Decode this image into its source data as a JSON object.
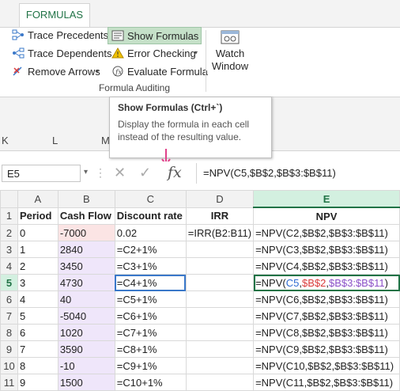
{
  "ribbon": {
    "tab_label": "FORMULAS",
    "items_left": [
      {
        "label": "Trace Precedents",
        "icon": "trace-precedents-icon"
      },
      {
        "label": "Trace Dependents",
        "icon": "trace-dependents-icon"
      },
      {
        "label": "Remove Arrows",
        "icon": "remove-arrows-icon"
      }
    ],
    "items_right": [
      {
        "label": "Show Formulas",
        "icon": "show-formulas-icon",
        "active": true
      },
      {
        "label": "Error Checking",
        "icon": "error-checking-icon"
      },
      {
        "label": "Evaluate Formula",
        "icon": "evaluate-formula-icon"
      }
    ],
    "group_label": "Formula Auditing",
    "watch_window_line1": "Watch",
    "watch_window_line2": "Window"
  },
  "tooltip": {
    "title": "Show Formulas (Ctrl+`)",
    "line1": "Display the formula in each cell",
    "line2": "instead of the resulting value."
  },
  "old_columns": [
    "K",
    "L",
    "M"
  ],
  "formula_bar": {
    "name_box": "E5",
    "fx_label": "fx",
    "formula": "=NPV(C5,$B$2,$B$3:$B$11)"
  },
  "sheet": {
    "columns": [
      "A",
      "B",
      "C",
      "D",
      "E"
    ],
    "rows": [
      {
        "n": "1",
        "cells": [
          "Period",
          "Cash Flow",
          "Discount rate",
          "IRR",
          "NPV"
        ]
      },
      {
        "n": "2",
        "cells": [
          "0",
          "-7000",
          "0.02",
          "=IRR(B2:B11)",
          "=NPV(C2,$B$2,$B$3:$B$11)"
        ]
      },
      {
        "n": "3",
        "cells": [
          "1",
          "2840",
          "=C2+1%",
          "",
          "=NPV(C3,$B$2,$B$3:$B$11)"
        ]
      },
      {
        "n": "4",
        "cells": [
          "2",
          "3450",
          "=C3+1%",
          "",
          "=NPV(C4,$B$2,$B$3:$B$11)"
        ]
      },
      {
        "n": "5",
        "cells": [
          "3",
          "4730",
          "=C4+1%",
          "",
          "=NPV(C5,$B$2,$B$3:$B$11)"
        ]
      },
      {
        "n": "6",
        "cells": [
          "4",
          "40",
          "=C5+1%",
          "",
          "=NPV(C6,$B$2,$B$3:$B$11)"
        ]
      },
      {
        "n": "7",
        "cells": [
          "5",
          "-5040",
          "=C6+1%",
          "",
          "=NPV(C7,$B$2,$B$3:$B$11)"
        ]
      },
      {
        "n": "8",
        "cells": [
          "6",
          "1020",
          "=C7+1%",
          "",
          "=NPV(C8,$B$2,$B$3:$B$11)"
        ]
      },
      {
        "n": "9",
        "cells": [
          "7",
          "3590",
          "=C8+1%",
          "",
          "=NPV(C9,$B$2,$B$3:$B$11)"
        ]
      },
      {
        "n": "10",
        "cells": [
          "8",
          "-10",
          "=C9+1%",
          "",
          "=NPV(C10,$B$2,$B$3:$B$11)"
        ]
      },
      {
        "n": "11",
        "cells": [
          "9",
          "1500",
          "=C10+1%",
          "",
          "=NPV(C11,$B$2,$B$3:$B$11)"
        ]
      }
    ],
    "active_formula_parts": {
      "open": "=NPV(",
      "ref1": "C5",
      "c1": ",",
      "ref2": "$B$2",
      "c2": ",",
      "ref3": "$B$3:$B$11",
      "close": ")"
    }
  },
  "colors": {
    "accent": "#217346",
    "ref_blue": "#2e6bd1",
    "ref_red": "#d93a3a",
    "ref_purple": "#8a4fc7"
  }
}
